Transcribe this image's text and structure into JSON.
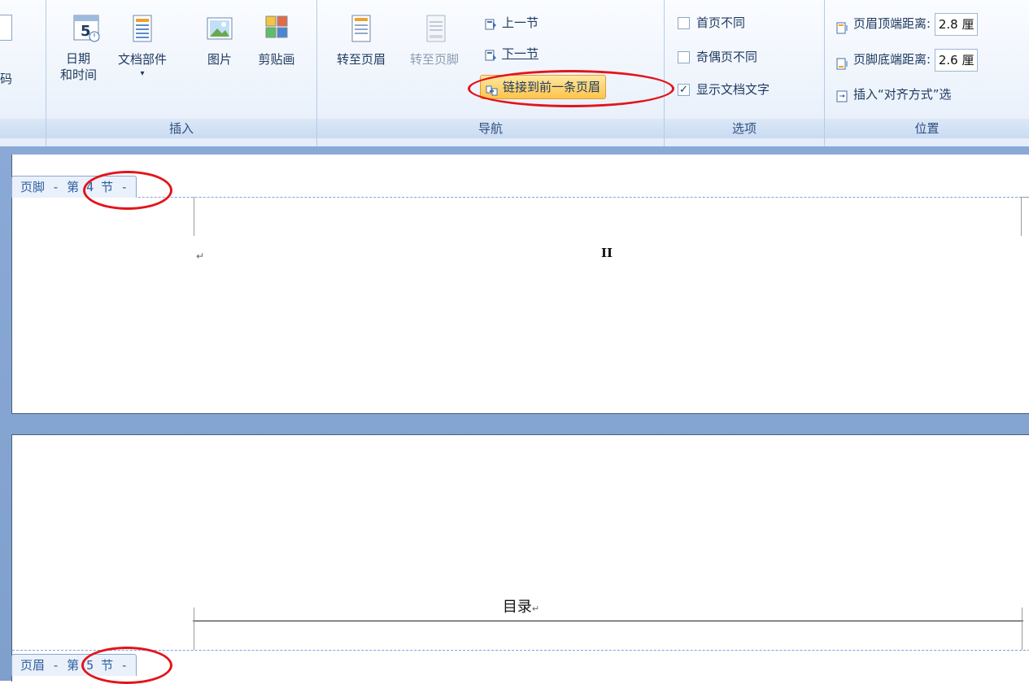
{
  "ribbon": {
    "page_number_fragment": "码",
    "insert": {
      "label": "插入",
      "datetime_line1": "日期",
      "datetime_line2": "和时间",
      "datetime_icon_digit": "5",
      "quickparts": "文档部件",
      "picture": "图片",
      "clipart": "剪贴画"
    },
    "navigation": {
      "label": "导航",
      "goto_header": "转至页眉",
      "goto_footer": "转至页脚",
      "prev_section": "上一节",
      "next_section": "下一节",
      "link_previous": "链接到前一条页眉"
    },
    "options": {
      "label": "选项",
      "diff_first": "首页不同",
      "diff_odd_even": "奇偶页不同",
      "show_doc_text": "显示文档文字"
    },
    "position": {
      "label": "位置",
      "header_from_top_label": "页眉顶端距离:",
      "header_from_top_value": "2.8 厘",
      "footer_from_bottom_label": "页脚底端距离:",
      "footer_from_bottom_value": "2.6 厘",
      "insert_align_tab": "插入“对齐方式”选"
    }
  },
  "document": {
    "page1": {
      "footer_tab": "页脚 - 第 4 节 -",
      "page_number": "II",
      "para_mark": "↵"
    },
    "page2": {
      "header_text": "目录",
      "para_mark": "↵",
      "header_tab": "页眉 - 第 5 节 -"
    }
  },
  "colors": {
    "highlight_orange": "#ffd36b",
    "annotation_red": "#e3141b",
    "ribbon_text": "#1f3a60"
  }
}
